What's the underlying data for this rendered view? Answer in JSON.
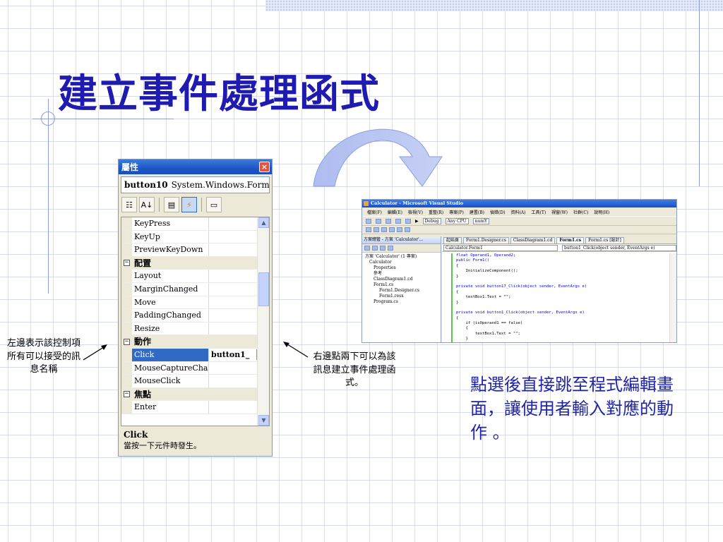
{
  "title": "建立事件處理函式",
  "properties_panel": {
    "title": "屬性",
    "object_name": "button10",
    "object_type": "System.Windows.Forms.Bu",
    "rows": [
      {
        "kind": "prop",
        "name": "KeyPress",
        "value": ""
      },
      {
        "kind": "prop",
        "name": "KeyUp",
        "value": ""
      },
      {
        "kind": "prop",
        "name": "PreviewKeyDown",
        "value": ""
      },
      {
        "kind": "cat",
        "name": "配置"
      },
      {
        "kind": "prop",
        "name": "Layout",
        "value": ""
      },
      {
        "kind": "prop",
        "name": "MarginChanged",
        "value": ""
      },
      {
        "kind": "prop",
        "name": "Move",
        "value": ""
      },
      {
        "kind": "prop",
        "name": "PaddingChanged",
        "value": ""
      },
      {
        "kind": "prop",
        "name": "Resize",
        "value": ""
      },
      {
        "kind": "cat",
        "name": "動作"
      },
      {
        "kind": "prop",
        "name": "Click",
        "value": "button1_",
        "selected": true
      },
      {
        "kind": "prop",
        "name": "MouseCaptureChange",
        "value": ""
      },
      {
        "kind": "prop",
        "name": "MouseClick",
        "value": ""
      },
      {
        "kind": "cat",
        "name": "焦點"
      },
      {
        "kind": "prop",
        "name": "Enter",
        "value": ""
      }
    ],
    "description_title": "Click",
    "description_text": "當按一下元件時發生。"
  },
  "annotations": {
    "left": "左邊表示該控制項所有可以接受的訊息名稱",
    "right": "右邊點兩下可以為該訊息建立事件處理函式。",
    "main": "點選後直接跳至程式編輯畫面，讓使用者輸入對應的動作 。"
  },
  "vs_window": {
    "title": "Calculator - Microsoft Visual Studio",
    "menu": [
      "檔案(F)",
      "編輯(E)",
      "檢視(V)",
      "重整(R)",
      "專案(P)",
      "建置(B)",
      "偵錯(D)",
      "資料(A)",
      "工具(T)",
      "視窗(W)",
      "社群(C)",
      "說明(H)"
    ],
    "config": "Debug",
    "platform": "Any CPU",
    "find_target": "numY",
    "solution_header": "方案總管 - 方案 'Calculator'...",
    "tree": [
      "方案 'Calculator' (1 專案)",
      "Calculator",
      "Properties",
      "參考",
      "ClassDiagram1.cd",
      "Form1.cs",
      "Form1.Designer.cs",
      "Form1.resx",
      "Program.cs"
    ],
    "tabs": [
      "起始頁",
      "Form1.Designer.cs",
      "ClassDiagram1.cd",
      "Form1.cs",
      "Form1.cs [設計]"
    ],
    "active_tab": "Form1.cs",
    "nav_class": "Calculator.Form1",
    "nav_member": "button1_Click(object sender, EventArgs e)",
    "code_lines": [
      "float Operand1, Operand2;",
      "public Form1()",
      "{",
      "    InitializeComponent();",
      "}",
      "",
      "private void button17_Click(object sender, EventArgs e)",
      "{",
      "    textBox1.Text = \"\";",
      "}",
      "",
      "private void button1_Click(object sender, EventArgs e)",
      "{",
      "    if (isOperand1 == false)",
      "    {",
      "        textBox1.Text = \"\";",
      "    }"
    ]
  }
}
